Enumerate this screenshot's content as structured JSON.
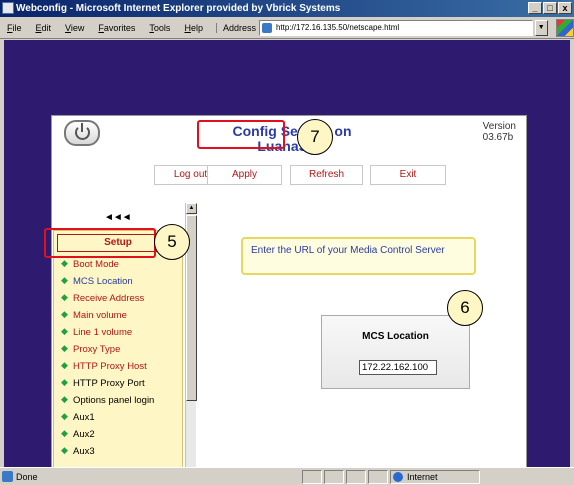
{
  "window": {
    "title": "Webconfig - Microsoft Internet Explorer provided by Vbrick Systems",
    "minimize": "_",
    "maximize": "□",
    "close": "x"
  },
  "menu": {
    "items": [
      "File",
      "Edit",
      "View",
      "Favorites",
      "Tools",
      "Help"
    ],
    "address_label": "Address",
    "address_value": "http://172.16.135.50/netscape.html"
  },
  "status": {
    "text": "Done",
    "zone": "Internet"
  },
  "app": {
    "title_line1": "Config Service on",
    "title_line2": "LuanaSTB",
    "version_label": "Version",
    "version_value": "03.67b",
    "buttons": {
      "logout": "Log out",
      "apply": "Apply",
      "refresh": "Refresh",
      "exit": "Exit"
    },
    "back_arrows": "◄◄◄",
    "nav": {
      "header": "Setup",
      "items": [
        {
          "label": "Boot Mode",
          "color": "#b01818"
        },
        {
          "label": "MCS Location",
          "color": "#2b3ba0"
        },
        {
          "label": "Receive Address",
          "color": "#b01818"
        },
        {
          "label": "Main volume",
          "color": "#b01818"
        },
        {
          "label": "Line 1 volume",
          "color": "#b01818"
        },
        {
          "label": "Proxy Type",
          "color": "#b01818"
        },
        {
          "label": "HTTP Proxy Host",
          "color": "#b01818"
        },
        {
          "label": "HTTP Proxy Port",
          "color": "#000000"
        },
        {
          "label": "Options panel login",
          "color": "#000000"
        },
        {
          "label": "Aux1",
          "color": "#000000"
        },
        {
          "label": "Aux2",
          "color": "#000000"
        },
        {
          "label": "Aux3",
          "color": "#000000"
        }
      ]
    },
    "info_text": "Enter the URL of your Media Control Server",
    "mcs": {
      "title": "MCS Location",
      "value": "172.22.162.100"
    }
  },
  "callouts": [
    "5",
    "6",
    "7"
  ],
  "colors": {
    "viewport_bg": "#2e1a6e",
    "accent_blue": "#2b3ba0",
    "accent_red": "#b01818",
    "highlight_red": "#e0101e",
    "nav_bg": "#fef6c4"
  }
}
